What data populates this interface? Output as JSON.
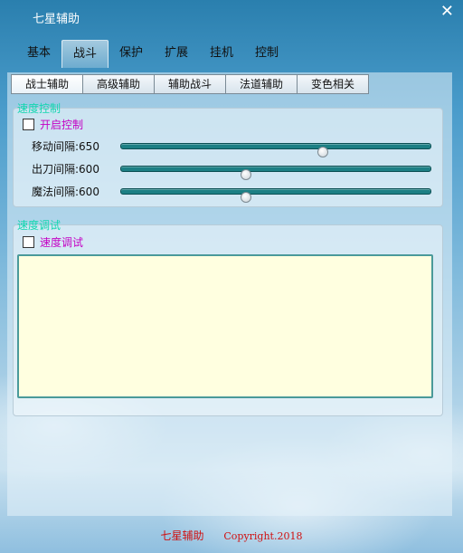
{
  "window": {
    "title": "七星辅助",
    "close_icon": "close-icon"
  },
  "main_tabs": [
    "基本",
    "战斗",
    "保护",
    "扩展",
    "挂机",
    "控制"
  ],
  "main_tab_active": "战斗",
  "sub_tabs": [
    "战士辅助",
    "高级辅助",
    "辅助战斗",
    "法道辅助",
    "变色相关"
  ],
  "sub_tab_active": "战士辅助",
  "speed_control": {
    "legend": "速度控制",
    "enable_label": "开启控制",
    "enabled": false,
    "sliders": [
      {
        "label": "移动间隔:650",
        "value": 650,
        "fraction": 0.65
      },
      {
        "label": "出刀间隔:600",
        "value": 600,
        "fraction": 0.4
      },
      {
        "label": "魔法间隔:600",
        "value": 600,
        "fraction": 0.4
      }
    ]
  },
  "speed_debug": {
    "legend": "速度调试",
    "checkbox_label": "速度调试",
    "checked": false,
    "log_text": ""
  },
  "footer": {
    "name": "七星辅助",
    "copyright": "Copyright.2018"
  },
  "colors": {
    "legend": "#14d6b0",
    "checkbox_label": "#c400c4",
    "footer": "#d01010",
    "textbox_bg": "#ffffe0",
    "slider_track": "#1c7f84"
  }
}
